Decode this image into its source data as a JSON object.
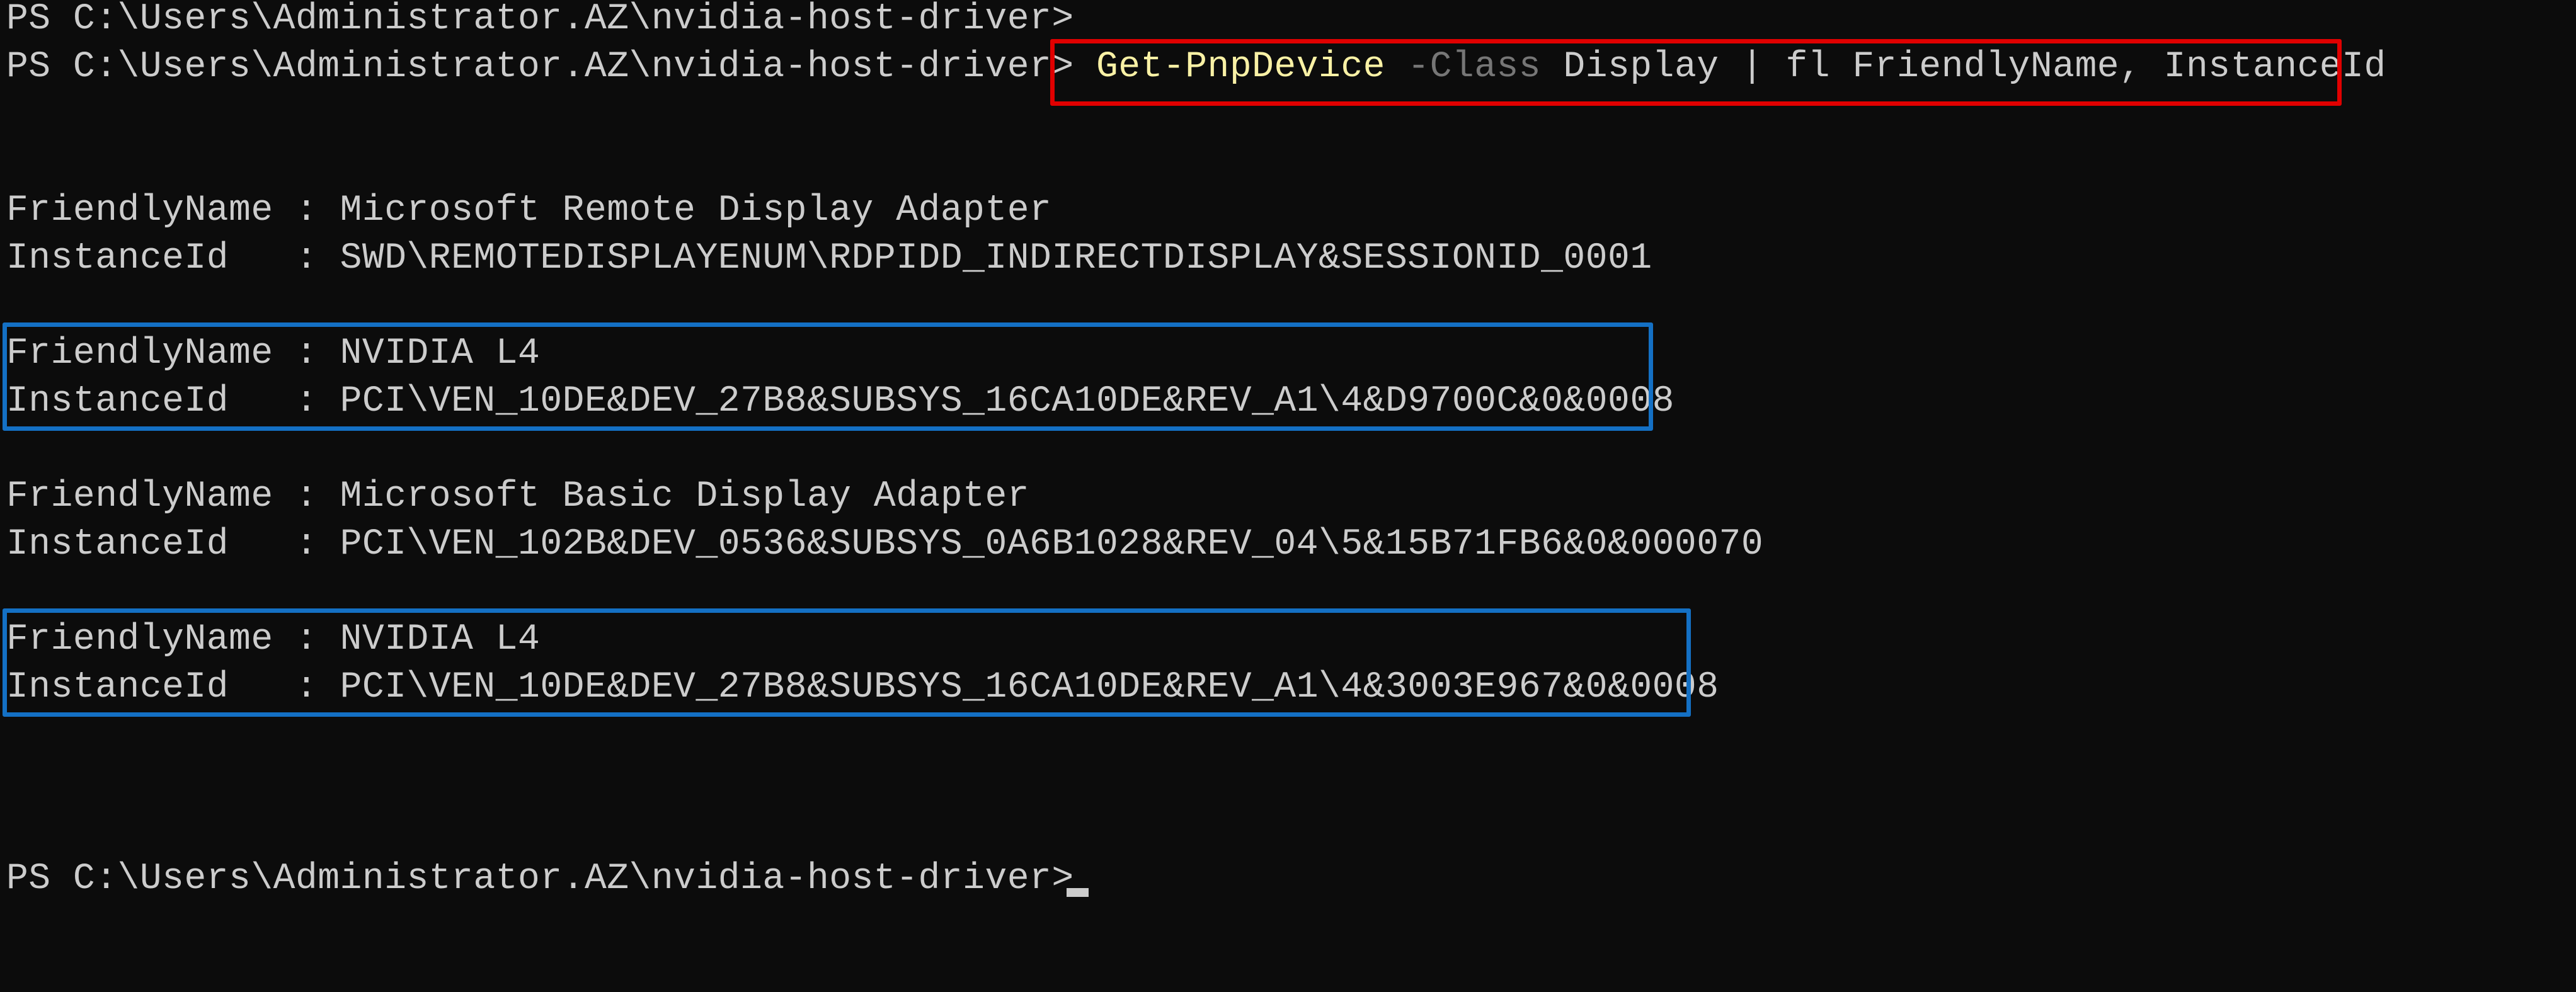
{
  "terminal": {
    "prompt": "PS C:\\Users\\Administrator.AZ\\nvidia-host-driver>",
    "command": {
      "cmdlet": "Get-PnpDevice",
      "param": " -Class",
      "rest": " Display | fl FriendlyName, InstanceId"
    },
    "devices": [
      {
        "friendly_line": "FriendlyName : Microsoft Remote Display Adapter",
        "instance_line": "InstanceId   : SWD\\REMOTEDISPLAYENUM\\RDPIDD_INDIRECTDISPLAY&SESSIONID_0001"
      },
      {
        "friendly_line": "FriendlyName : NVIDIA L4",
        "instance_line": "InstanceId   : PCI\\VEN_10DE&DEV_27B8&SUBSYS_16CA10DE&REV_A1\\4&D9700C&0&0008"
      },
      {
        "friendly_line": "FriendlyName : Microsoft Basic Display Adapter",
        "instance_line": "InstanceId   : PCI\\VEN_102B&DEV_0536&SUBSYS_0A6B1028&REV_04\\5&15B71FB6&0&000070"
      },
      {
        "friendly_line": "FriendlyName : NVIDIA L4",
        "instance_line": "InstanceId   : PCI\\VEN_10DE&DEV_27B8&SUBSYS_16CA10DE&REV_A1\\4&3003E967&0&0008"
      }
    ]
  },
  "colors": {
    "background": "#0c0c0c",
    "text": "#cccccc",
    "cmdlet": "#f9f1a5",
    "parameter": "#767676",
    "highlight_command": "#e00000",
    "highlight_device": "#1470c4"
  }
}
